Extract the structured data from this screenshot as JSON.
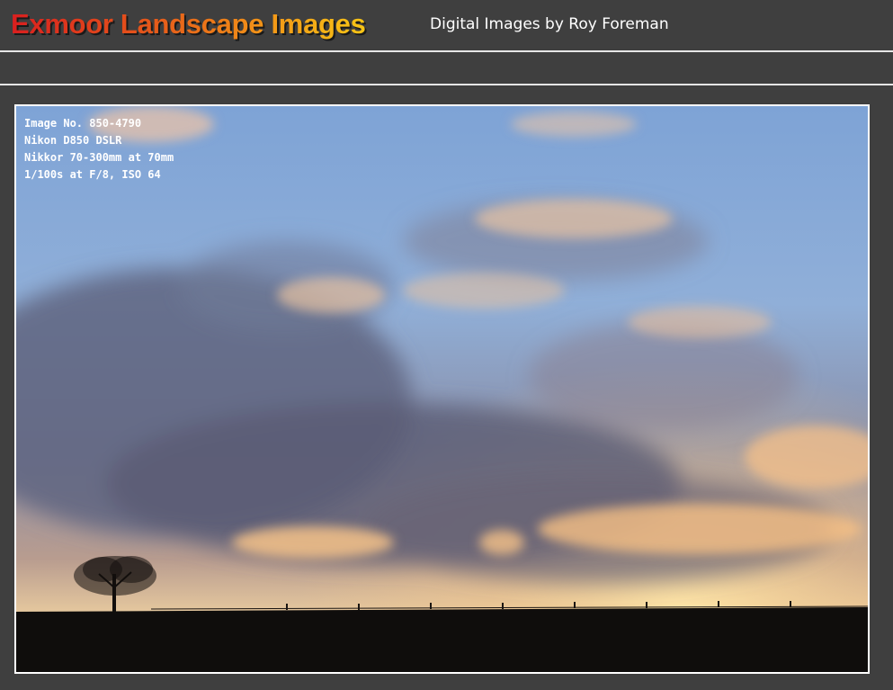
{
  "header": {
    "title": "Exmoor Landscape Images",
    "subtitle": "Digital Images by Roy Foreman"
  },
  "photo": {
    "caption_lines": [
      "Image No. 850-4790",
      "Nikon D850 DSLR",
      "Nikkor 70-300mm at 70mm",
      "1/100s at F/8, ISO 64"
    ]
  },
  "colors": {
    "background": "#3f3f3f",
    "divider": "#e6e6e6",
    "title_start": "#d91f1f",
    "title_end": "#f7c516"
  }
}
